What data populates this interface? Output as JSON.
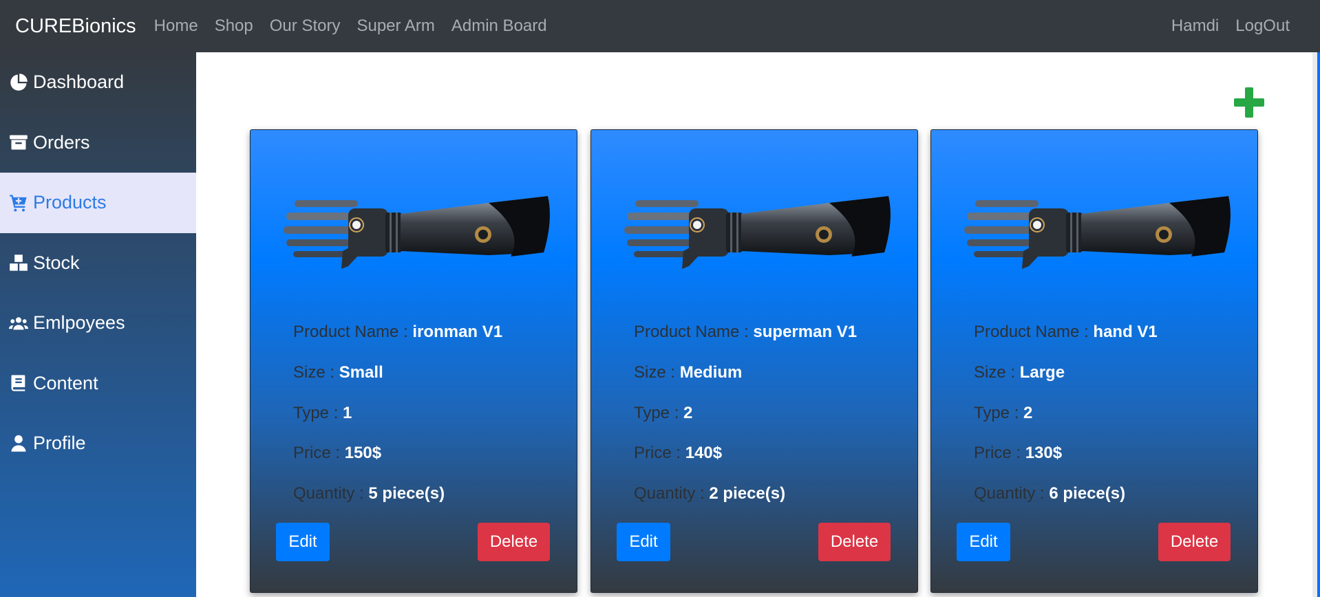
{
  "navbar": {
    "brand": "CUREBionics",
    "links": [
      "Home",
      "Shop",
      "Our Story",
      "Super Arm",
      "Admin Board"
    ],
    "user": "Hamdi",
    "logout": "LogOut"
  },
  "sidebar": {
    "items": [
      {
        "label": "Dashboard",
        "icon": "pie-chart-icon"
      },
      {
        "label": "Orders",
        "icon": "archive-box-icon"
      },
      {
        "label": "Products",
        "icon": "cart-plus-icon",
        "active": true
      },
      {
        "label": "Stock",
        "icon": "boxes-icon"
      },
      {
        "label": "Emlpoyees",
        "icon": "users-icon"
      },
      {
        "label": "Content",
        "icon": "book-icon"
      },
      {
        "label": "Profile",
        "icon": "user-icon"
      }
    ]
  },
  "main": {
    "add_icon": "plus-icon",
    "field_labels": {
      "name": "Product Name : ",
      "size": "Size : ",
      "type": "Type : ",
      "price": "Price : ",
      "quantity": "Quantity : "
    },
    "edit_label": "Edit",
    "delete_label": "Delete",
    "products": [
      {
        "name": "ironman V1",
        "size": "Small",
        "type": "1",
        "price": "150$",
        "quantity": "5 piece(s)",
        "image": "robotic-arm-image"
      },
      {
        "name": "superman V1",
        "size": "Medium",
        "type": "2",
        "price": "140$",
        "quantity": "2 piece(s)",
        "image": "robotic-arm-image"
      },
      {
        "name": "hand V1",
        "size": "Large",
        "type": "2",
        "price": "130$",
        "quantity": "6 piece(s)",
        "image": "robotic-arm-image"
      }
    ]
  },
  "colors": {
    "navbar": "#343a40",
    "active_bg": "#e6e6fa",
    "active_text": "#2c7be5",
    "card_top": "#007bff",
    "card_bottom": "#343a40",
    "edit": "#007bff",
    "delete": "#dc3545",
    "add": "#28a745"
  }
}
